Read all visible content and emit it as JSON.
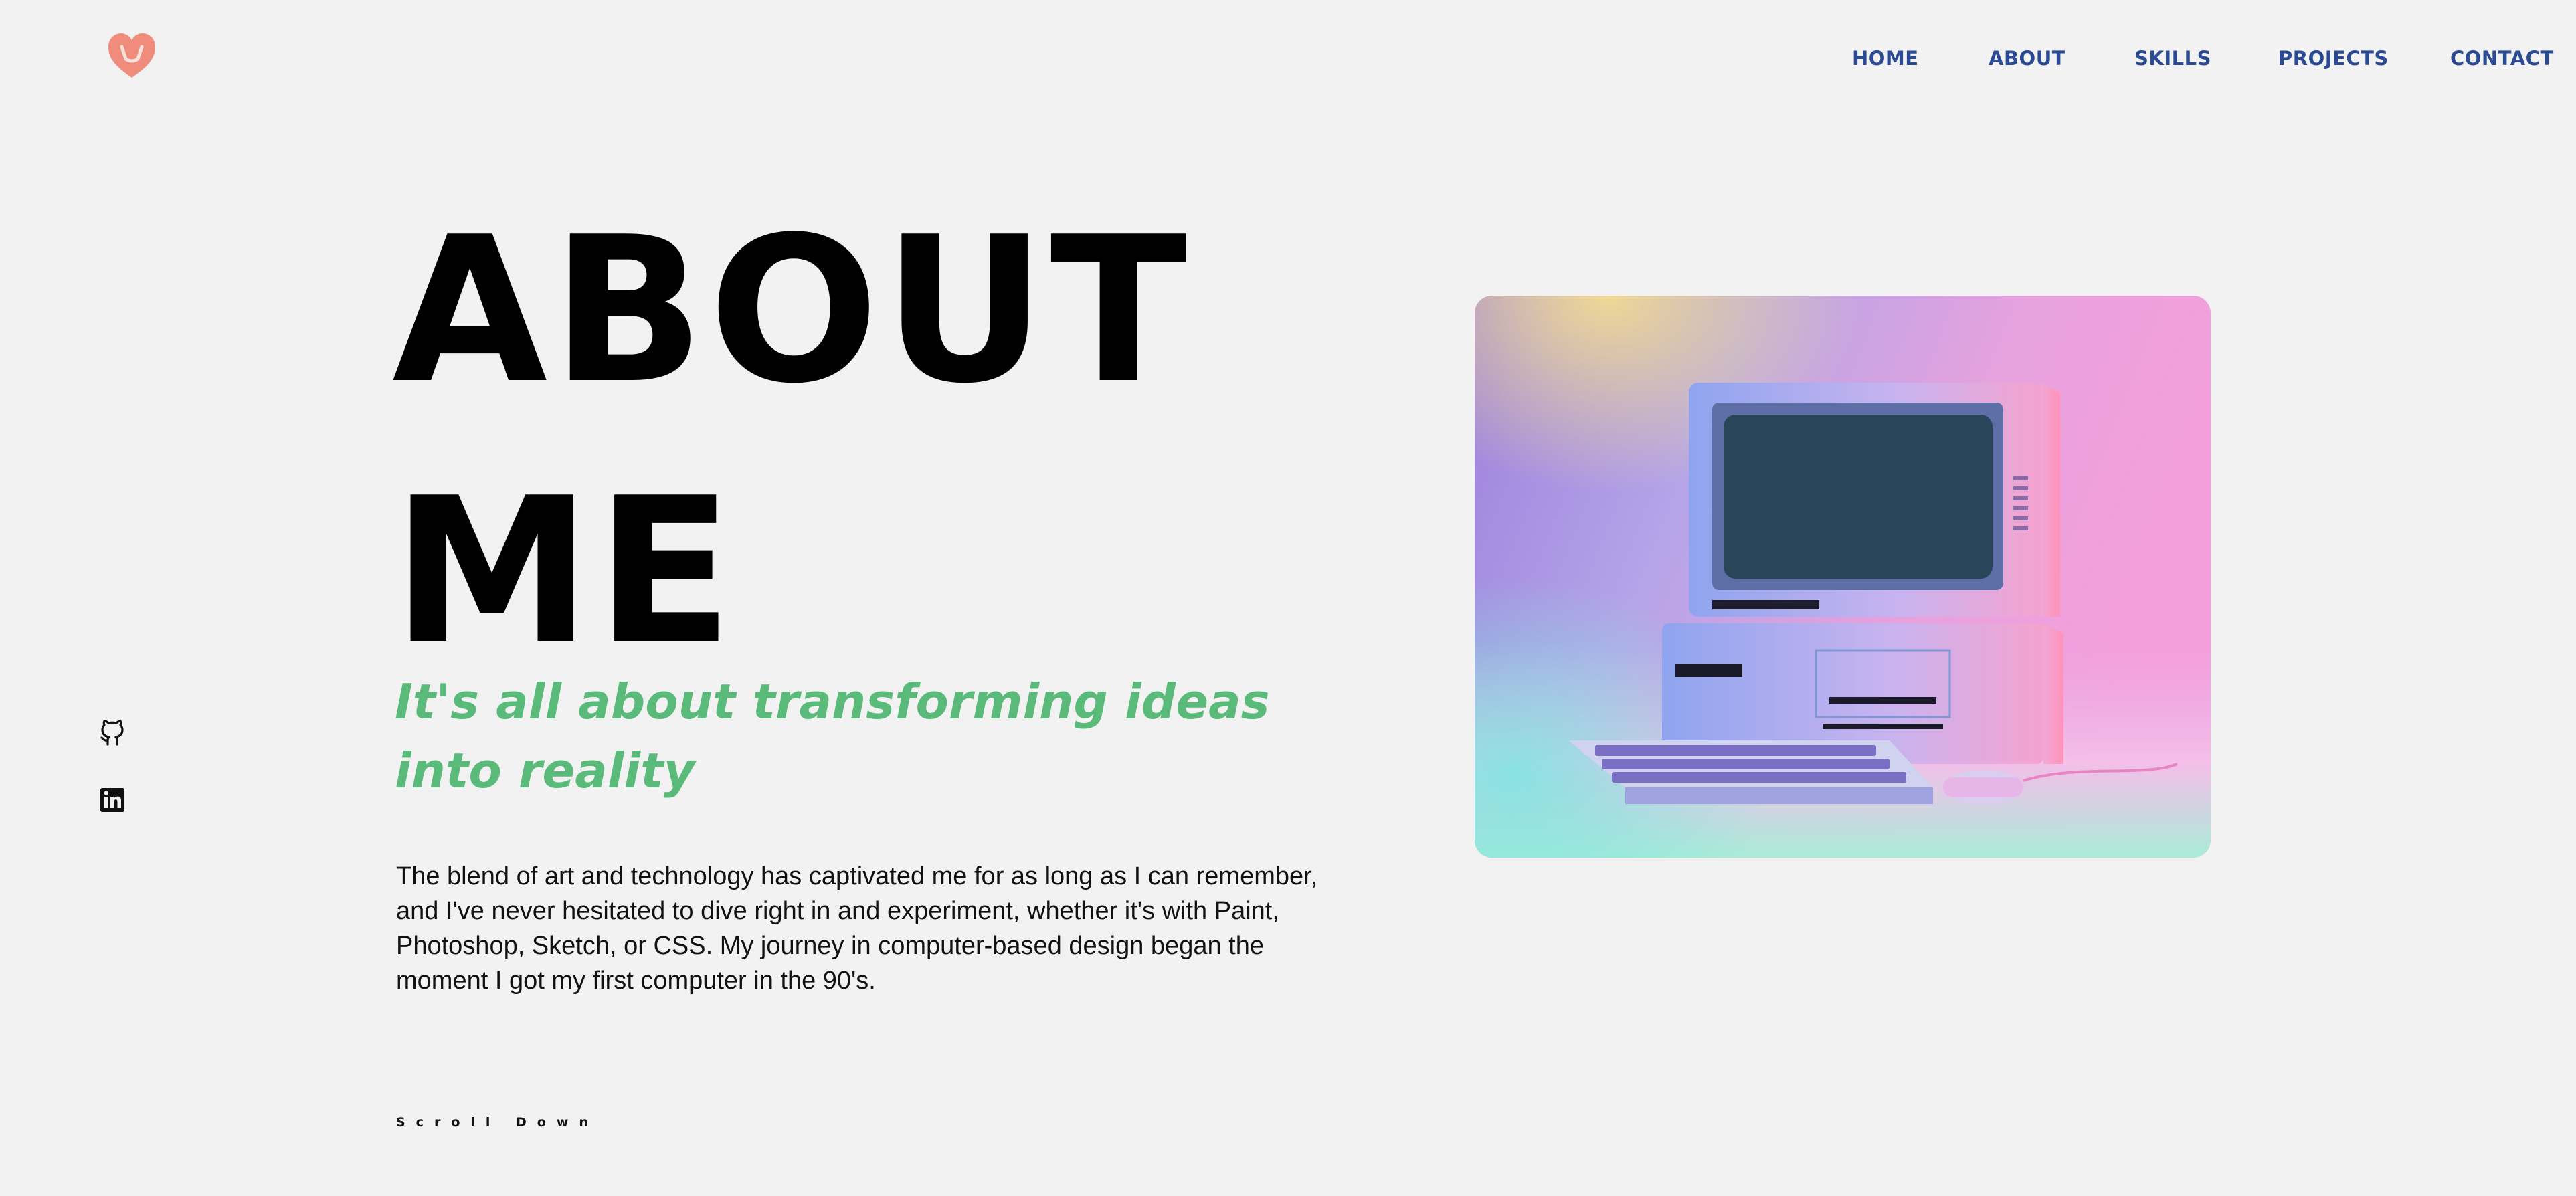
{
  "logo": {
    "icon": "heart-logo-icon",
    "color": "#ef8c7b"
  },
  "nav": {
    "color": "#2a4b93",
    "items": [
      {
        "label": "HOME"
      },
      {
        "label": "ABOUT"
      },
      {
        "label": "SKILLS"
      },
      {
        "label": "PROJECTS"
      },
      {
        "label": "CONTACT"
      }
    ]
  },
  "hero": {
    "title_line1": "ABOUT",
    "title_line2": "ME",
    "tagline": "It's all about transforming ideas into reality",
    "bio": "The blend of art and technology has captivated me for as long as I can remember, and I've never hesitated to dive right in and experiment, whether it's with Paint, Photoshop, Sketch, or CSS. My journey in computer-based design began the moment I got my first computer in the 90's.",
    "scroll_label": "Scroll Down",
    "tagline_color": "#5aba7a"
  },
  "social": [
    {
      "icon": "github-icon"
    },
    {
      "icon": "linkedin-icon"
    }
  ],
  "image": {
    "subject": "retro-computer-illustration"
  }
}
